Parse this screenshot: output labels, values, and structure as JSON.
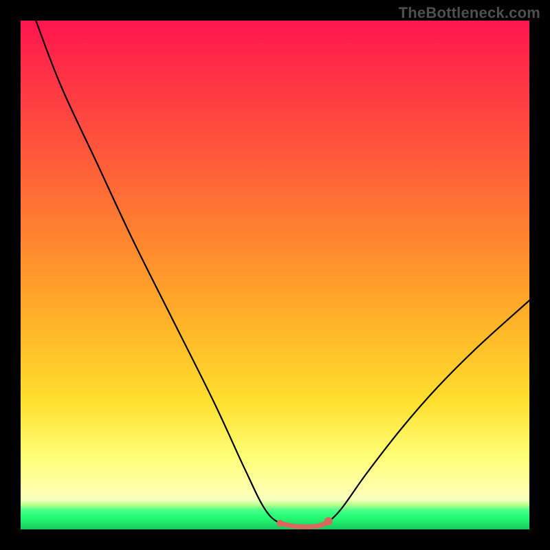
{
  "watermark": "TheBottleneck.com",
  "chart_data": {
    "type": "line",
    "title": "",
    "xlabel": "",
    "ylabel": "",
    "xlim": [
      0,
      100
    ],
    "ylim": [
      0,
      100
    ],
    "legend": false,
    "grid": false,
    "background_gradient": {
      "direction": "vertical",
      "stops": [
        {
          "pos": 0,
          "color": "#ff154e"
        },
        {
          "pos": 45,
          "color": "#ff8b2e"
        },
        {
          "pos": 75,
          "color": "#ffe02e"
        },
        {
          "pos": 92,
          "color": "#ffffb0"
        },
        {
          "pos": 96,
          "color": "#4fff8a"
        },
        {
          "pos": 100,
          "color": "#17c95c"
        }
      ]
    },
    "series": [
      {
        "name": "bottleneck-curve",
        "points": [
          {
            "x": 3,
            "y": 100
          },
          {
            "x": 8,
            "y": 87
          },
          {
            "x": 15,
            "y": 72
          },
          {
            "x": 22,
            "y": 57
          },
          {
            "x": 30,
            "y": 41
          },
          {
            "x": 38,
            "y": 25
          },
          {
            "x": 44,
            "y": 12
          },
          {
            "x": 48,
            "y": 4
          },
          {
            "x": 51,
            "y": 1.2
          },
          {
            "x": 54,
            "y": 0.6
          },
          {
            "x": 58,
            "y": 0.6
          },
          {
            "x": 60,
            "y": 1.2
          },
          {
            "x": 63,
            "y": 4
          },
          {
            "x": 68,
            "y": 11
          },
          {
            "x": 75,
            "y": 20
          },
          {
            "x": 82,
            "y": 28
          },
          {
            "x": 90,
            "y": 36
          },
          {
            "x": 100,
            "y": 45
          }
        ]
      },
      {
        "name": "flat-highlight-segment",
        "color": "#d8675e",
        "width": 7,
        "points": [
          {
            "x": 51,
            "y": 1.2
          },
          {
            "x": 54,
            "y": 0.6
          },
          {
            "x": 58,
            "y": 0.6
          },
          {
            "x": 60,
            "y": 1.2
          }
        ]
      }
    ],
    "markers": [
      {
        "x": 51,
        "y": 1.2,
        "color": "#d8675e",
        "r": 5
      },
      {
        "x": 60.5,
        "y": 1.6,
        "color": "#d8675e",
        "r": 6
      }
    ]
  }
}
